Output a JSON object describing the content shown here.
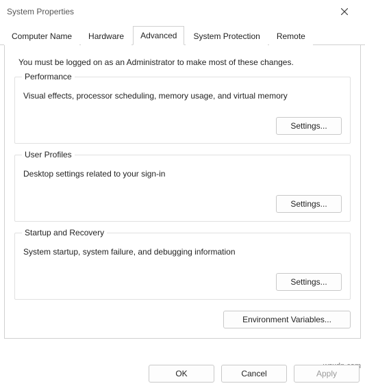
{
  "window": {
    "title": "System Properties"
  },
  "tabs": {
    "computer_name": "Computer Name",
    "hardware": "Hardware",
    "advanced": "Advanced",
    "system_protection": "System Protection",
    "remote": "Remote"
  },
  "intro": "You must be logged on as an Administrator to make most of these changes.",
  "groups": {
    "performance": {
      "legend": "Performance",
      "desc": "Visual effects, processor scheduling, memory usage, and virtual memory",
      "button": "Settings..."
    },
    "user_profiles": {
      "legend": "User Profiles",
      "desc": "Desktop settings related to your sign-in",
      "button": "Settings..."
    },
    "startup_recovery": {
      "legend": "Startup and Recovery",
      "desc": "System startup, system failure, and debugging information",
      "button": "Settings..."
    }
  },
  "env_button": "Environment Variables...",
  "footer": {
    "ok": "OK",
    "cancel": "Cancel",
    "apply": "Apply"
  },
  "watermark": "wsxdn.com"
}
